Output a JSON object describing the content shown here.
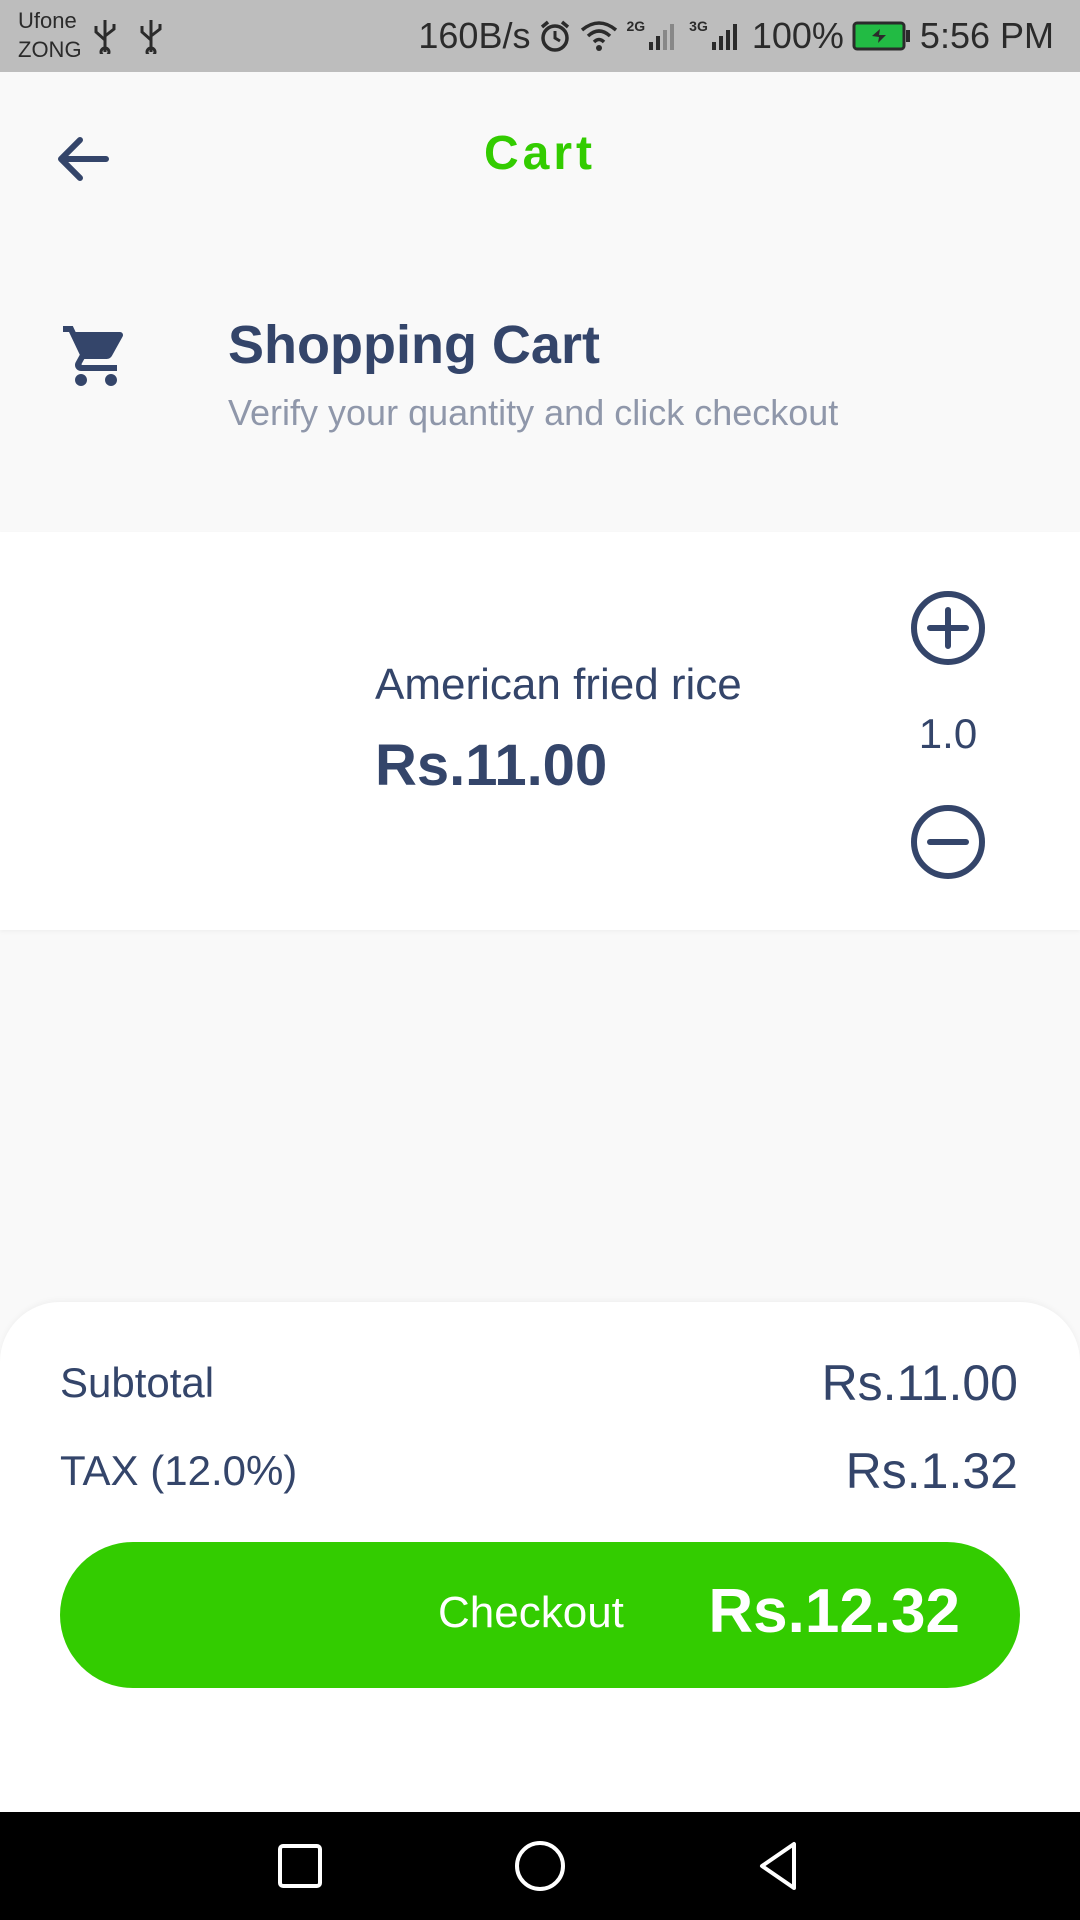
{
  "status_bar": {
    "carrier_1": "Ufone",
    "carrier_2": "ZONG",
    "net_speed": "160B/s",
    "net_gen_1": "2G",
    "net_gen_2": "3G",
    "battery": "100%",
    "time": "5:56 PM"
  },
  "header": {
    "title": "Cart",
    "back_icon": "arrow-left-icon"
  },
  "section": {
    "icon": "shopping-cart-icon",
    "title": "Shopping Cart",
    "subtitle": "Verify your quantity and click checkout"
  },
  "items": [
    {
      "name": "American fried rice",
      "price": "Rs.11.00",
      "quantity": "1.0"
    }
  ],
  "summary": {
    "subtotal_label": "Subtotal",
    "subtotal_value": "Rs.11.00",
    "tax_label": "TAX (12.0%)",
    "tax_value": "Rs.1.32",
    "checkout_label": "Checkout",
    "total": "Rs.12.32"
  },
  "colors": {
    "accent": "#33cc00",
    "text": "#34456a",
    "muted": "#8f97aa"
  }
}
